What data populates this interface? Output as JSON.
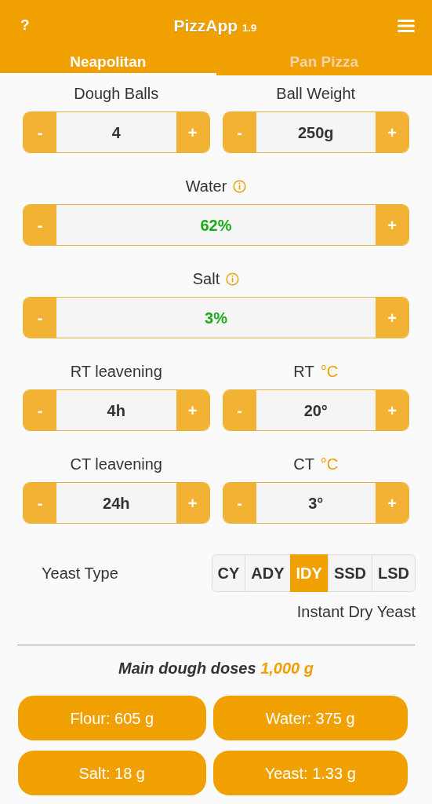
{
  "header": {
    "help": "?",
    "title": "PizzApp",
    "version": "1.9"
  },
  "tabs": [
    {
      "label": "Neapolitan",
      "selected": true
    },
    {
      "label": "Pan Pizza",
      "selected": false
    }
  ],
  "rows": [
    {
      "fields": [
        {
          "label": "Dough Balls",
          "info": false,
          "value": "4",
          "good": false,
          "minus": "-",
          "plus": "+"
        },
        {
          "label": "Ball Weight",
          "info": false,
          "value": "250g",
          "good": false,
          "minus": "-",
          "plus": "+"
        }
      ]
    },
    {
      "fields": [
        {
          "label": "Water",
          "info": true,
          "value": "62%",
          "good": true,
          "minus": "-",
          "plus": "+"
        }
      ]
    },
    {
      "fields": [
        {
          "label": "Salt",
          "info": true,
          "value": "3%",
          "good": true,
          "minus": "-",
          "plus": "+"
        }
      ]
    },
    {
      "fields": [
        {
          "label": "RT leavening",
          "info": false,
          "value": "4h",
          "good": false,
          "minus": "-",
          "plus": "+"
        },
        {
          "label": "RT",
          "unit": "°C",
          "info": false,
          "value": "20°",
          "good": false,
          "minus": "-",
          "plus": "+"
        }
      ]
    },
    {
      "fields": [
        {
          "label": "CT leavening",
          "info": false,
          "value": "24h",
          "good": false,
          "minus": "-",
          "plus": "+"
        },
        {
          "label": "CT",
          "unit": "°C",
          "info": false,
          "value": "3°",
          "good": false,
          "minus": "-",
          "plus": "+"
        }
      ]
    }
  ],
  "yeast": {
    "label": "Yeast Type",
    "options": [
      {
        "label": "CY",
        "selected": false
      },
      {
        "label": "ADY",
        "selected": false
      },
      {
        "label": "IDY",
        "selected": true
      },
      {
        "label": "SSD",
        "selected": false
      },
      {
        "label": "LSD",
        "selected": false
      }
    ],
    "description": "Instant Dry Yeast"
  },
  "doses": {
    "title": "Main dough doses",
    "total": "1,000 g",
    "items": [
      "Flour: 605 g",
      "Water: 375 g",
      "Salt: 18 g",
      "Yeast: 1.33 g"
    ]
  }
}
